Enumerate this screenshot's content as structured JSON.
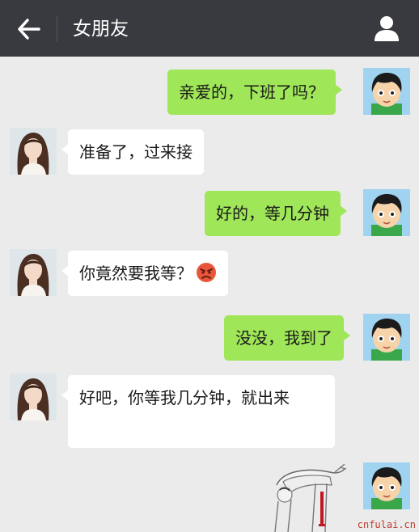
{
  "header": {
    "title": "女朋友",
    "back_icon": "arrow-left-icon",
    "profile_icon": "person-icon"
  },
  "colors": {
    "header_bg": "#393a3f",
    "chat_bg": "#ebebeb",
    "sent_bubble": "#9fe658",
    "received_bubble": "#ffffff"
  },
  "messages": [
    {
      "sender": "me",
      "text": "亲爱的，下班了吗？"
    },
    {
      "sender": "girlfriend",
      "text": "准备了，过来接"
    },
    {
      "sender": "me",
      "text": "好的，等几分钟"
    },
    {
      "sender": "girlfriend",
      "text": "你竟然要我等？",
      "emoji": "angry-face-icon"
    },
    {
      "sender": "me",
      "text": "没没，我到了"
    },
    {
      "sender": "girlfriend",
      "text": "好吧，你等我几分钟，就出来"
    },
    {
      "sender": "me",
      "sticker": "bowing-vomiting-blood-sticker"
    }
  ],
  "watermark": "cnfulai.cn"
}
